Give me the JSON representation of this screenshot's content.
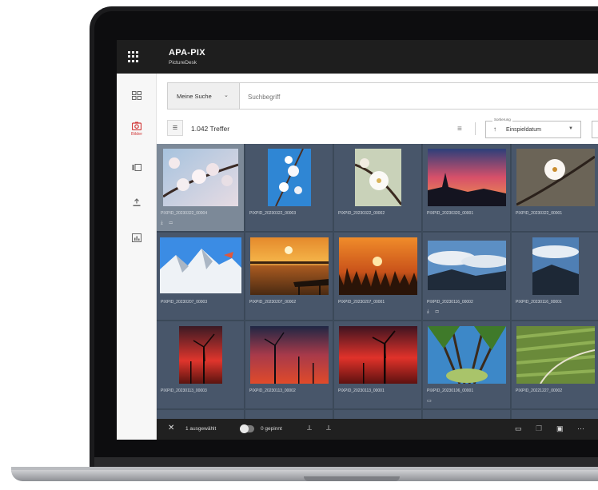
{
  "app": {
    "title": "APA-PIX",
    "subtitle": "PictureDesk",
    "apps_icon": "grid-apps-icon"
  },
  "sidebar": {
    "items": [
      {
        "icon": "dashboard-icon",
        "label": ""
      },
      {
        "icon": "camera-icon",
        "label": "Bilder",
        "active": true
      },
      {
        "icon": "video-icon",
        "label": ""
      },
      {
        "icon": "upload-icon",
        "label": ""
      },
      {
        "icon": "chart-icon",
        "label": ""
      }
    ]
  },
  "search": {
    "scope_label": "Meine Suche",
    "placeholder": "Suchbegriff"
  },
  "toolbar": {
    "hits": "1.042 Treffer",
    "sort_legend": "Sortierung",
    "sort_value": "Einspieldatum"
  },
  "gallery": {
    "tiles": [
      {
        "caption": "PIXPID_20230322_00004",
        "tools": "⤓ ▭",
        "selected": true
      },
      {
        "caption": "PIXPID_20230322_00003"
      },
      {
        "caption": "PIXPID_20230322_00002"
      },
      {
        "caption": "PIXPID_20230320_00001"
      },
      {
        "caption": "PIXPID_20230322_00001"
      },
      {
        "caption": "PIXPID_20230207_00003"
      },
      {
        "caption": "PIXPID_20230207_00002"
      },
      {
        "caption": "PIXPID_20230207_00001"
      },
      {
        "caption": "PIXPID_20230116_00002",
        "tools": "⤓ ▭"
      },
      {
        "caption": "PIXPID_20230116_00001"
      },
      {
        "caption": "PIXPID_20230113_00003"
      },
      {
        "caption": "PIXPID_20230113_00002"
      },
      {
        "caption": "PIXPID_20230113_00001"
      },
      {
        "caption": "PIXPID_20230106_00001",
        "tools": "▭"
      },
      {
        "caption": "PIXPID_20221227_00002"
      }
    ]
  },
  "statusbar": {
    "selected": "1 ausgewählt",
    "pinned": "0 gepinnt"
  }
}
